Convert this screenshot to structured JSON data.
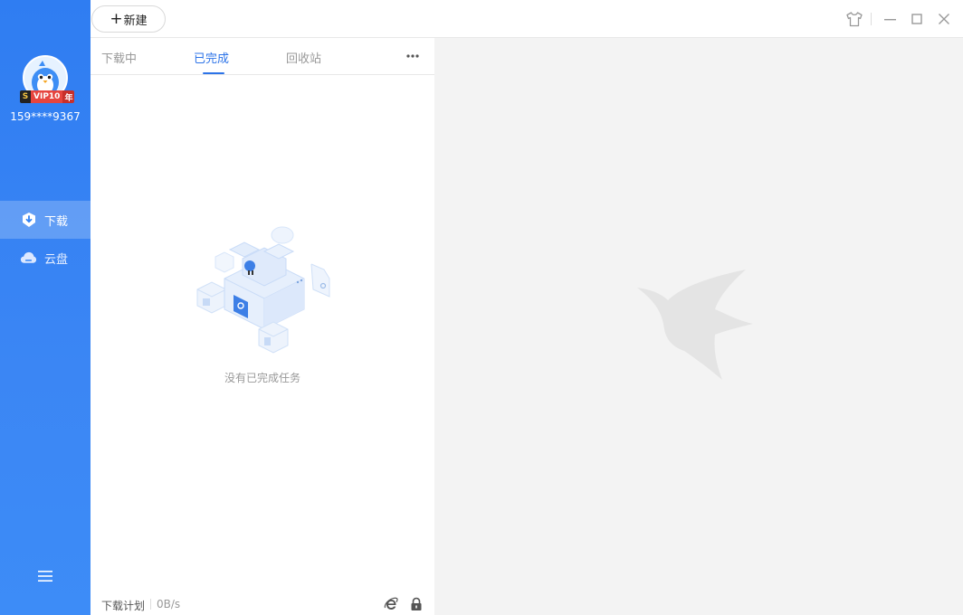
{
  "sidebar": {
    "username": "159****9367",
    "vip": {
      "s": "S",
      "label": "VIP10",
      "suffix": "年"
    },
    "items": [
      {
        "label": "下载",
        "icon": "download-shield-icon",
        "active": true
      },
      {
        "label": "云盘",
        "icon": "cloud-icon",
        "active": false
      }
    ],
    "menu_icon": "hamburger-menu-icon"
  },
  "toolbar": {
    "new_plus": "+",
    "new_label": "新建",
    "icons": [
      "skin-tshirt-icon",
      "minimize-icon",
      "maximize-icon",
      "close-icon"
    ]
  },
  "tabs": [
    {
      "label": "下载中",
      "active": false
    },
    {
      "label": "已完成",
      "active": true
    },
    {
      "label": "回收站",
      "active": false
    }
  ],
  "more_icon": "more-dots-icon",
  "empty_message": "没有已完成任务",
  "footer": {
    "plan_label": "下载计划",
    "speed": "0B/s",
    "icons": [
      "ie-browser-icon",
      "lock-icon"
    ]
  },
  "colors": {
    "accent": "#2c73e8",
    "sidebar": "#3383f4",
    "detail_bg": "#f3f3f3"
  }
}
